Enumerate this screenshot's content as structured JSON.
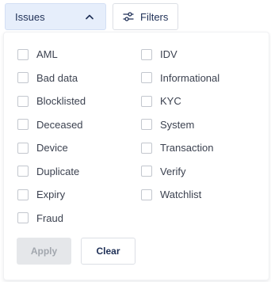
{
  "toolbar": {
    "issues_label": "Issues",
    "issues_icon": "chevron-up-icon",
    "filters_label": "Filters",
    "filters_icon": "sliders-icon"
  },
  "panel": {
    "left_options": [
      "AML",
      "Bad data",
      "Blocklisted",
      "Deceased",
      "Device",
      "Duplicate",
      "Expiry",
      "Fraud"
    ],
    "right_options": [
      "IDV",
      "Informational",
      "KYC",
      "System",
      "Transaction",
      "Verify",
      "Watchlist"
    ],
    "apply_label": "Apply",
    "clear_label": "Clear"
  },
  "colors": {
    "accent_bg": "#e6eefb",
    "text_dark": "#1e2f56",
    "text_body": "#3c4250",
    "disabled_bg": "#e5e7ea",
    "disabled_text": "#a2a7ae"
  }
}
